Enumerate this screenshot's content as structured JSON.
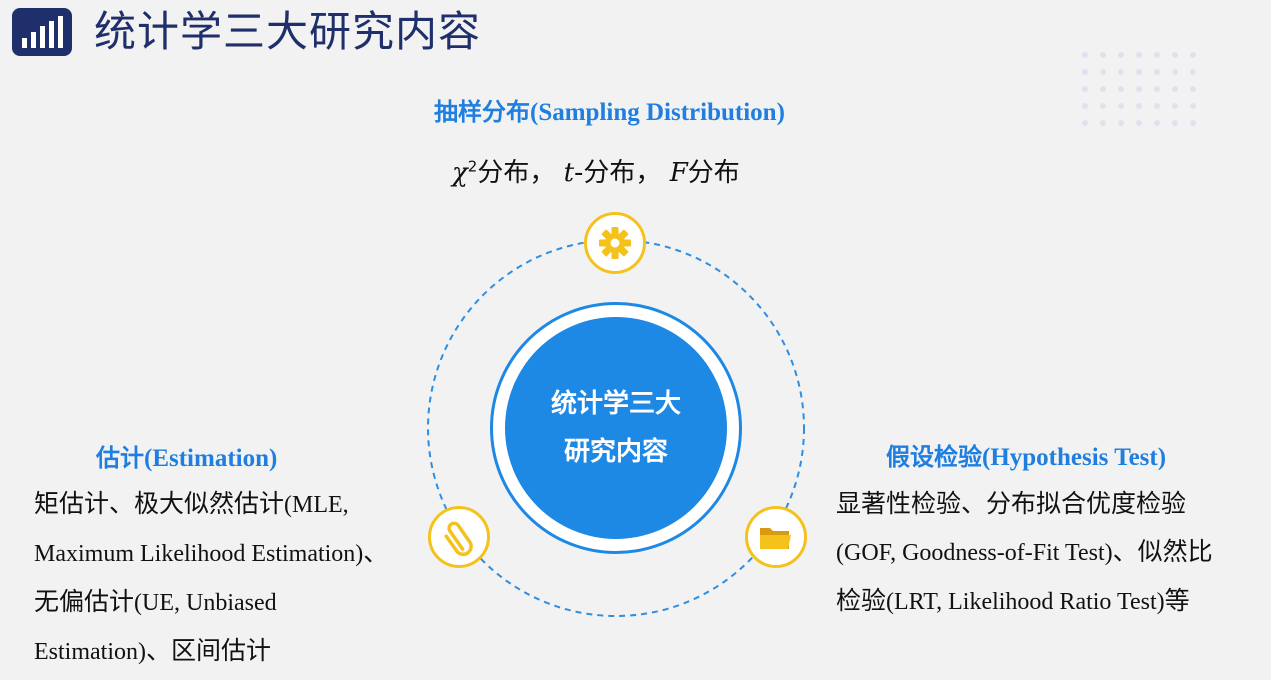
{
  "header": {
    "title": "统计学三大研究内容",
    "logo_icon": "bar-chart-icon"
  },
  "center": {
    "line1": "统计学三大",
    "line2": "研究内容"
  },
  "sampling": {
    "title_cn": "抽样分布",
    "title_en": "(Sampling Distribution)",
    "chi_symbol": "χ",
    "chi_sup": "2",
    "chi_suffix": "分布，",
    "t_symbol": "t",
    "t_suffix": "-分布，",
    "f_symbol": "F",
    "f_suffix": "分布",
    "icon": "gear-icon"
  },
  "estimation": {
    "title_cn": "估计",
    "title_en": "(Estimation)",
    "line1_cn": "矩估计、极大似然估计",
    "line1_en": "(MLE,",
    "line2_en": "Maximum Likelihood Estimation)",
    "line2_cn": "、",
    "line3_cn": "无偏估计",
    "line3_en": "(UE, Unbiased",
    "line4_en": "Estimation)",
    "line4_cn": "、区间估计",
    "icon": "paperclip-icon"
  },
  "hypothesis": {
    "title_cn": "假设检验",
    "title_en": "(Hypothesis Test)",
    "line1_cn": "显著性检验、分布拟合优度检验",
    "line2_en": "(GOF, Goodness-of-Fit Test)",
    "line2_cn": "、似然比",
    "line3_cn": "检验",
    "line3_en": "(LRT, Likelihood Ratio Test)",
    "line3_suffix": "等",
    "icon": "folder-icon"
  },
  "colors": {
    "accent_blue": "#1e88e5",
    "title_navy": "#1f2f6b",
    "icon_gold": "#f5c21b"
  }
}
